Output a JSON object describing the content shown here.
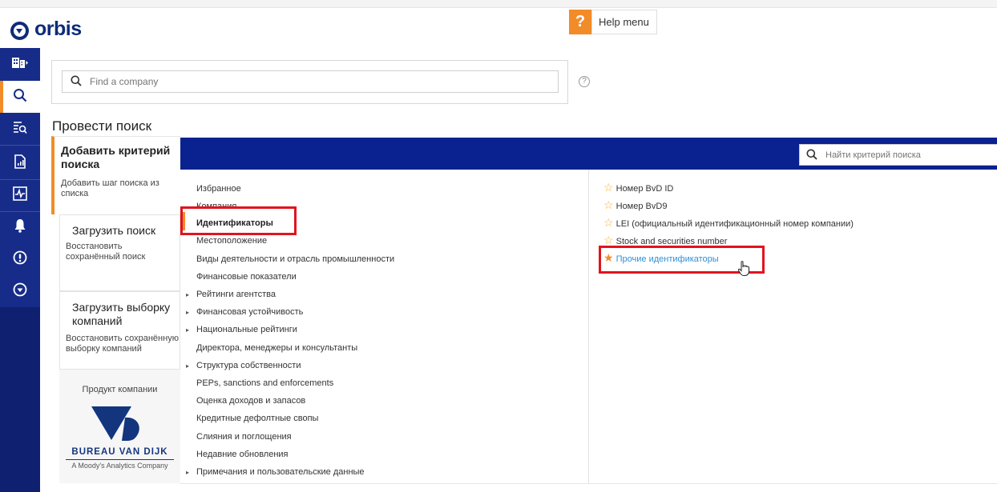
{
  "app": {
    "logo_text": "orbis"
  },
  "help": {
    "icon_glyph": "?",
    "label": "Help menu"
  },
  "search": {
    "placeholder": "Find a company",
    "help_glyph": "?"
  },
  "page": {
    "section_title": "Провести поиск"
  },
  "left_panel": {
    "add": {
      "title": "Добавить критерий поиска",
      "desc": "Добавить шаг поиска из списка"
    },
    "load_search": {
      "title": "Загрузить поиск",
      "desc": "Восстановить сохранённый поиск"
    },
    "load_selection": {
      "title": "Загрузить выборку компаний",
      "desc": "Восстановить сохранённую выборку компаний"
    },
    "footer": {
      "product_label": "Продукт компании",
      "brand": "BUREAU VAN DIJK",
      "tagline": "A Moody's Analytics Company"
    }
  },
  "criteria_search": {
    "placeholder": "Найти критерий поиска"
  },
  "categories": [
    {
      "label": "Избранное",
      "arrow": false
    },
    {
      "label": "Компания",
      "arrow": false
    },
    {
      "label": "Идентификаторы",
      "arrow": false,
      "selected": true
    },
    {
      "label": "Местоположение",
      "arrow": false
    },
    {
      "label": "Виды деятельности и отрасль промышленности",
      "arrow": false
    },
    {
      "label": "Финансовые показатели",
      "arrow": false
    },
    {
      "label": "Рейтинги агентства",
      "arrow": true
    },
    {
      "label": "Финансовая устойчивость",
      "arrow": true
    },
    {
      "label": "Национальные рейтинги",
      "arrow": true
    },
    {
      "label": "Директора, менеджеры и консультанты",
      "arrow": false
    },
    {
      "label": "Структура собственности",
      "arrow": true
    },
    {
      "label": "PEPs, sanctions and enforcements",
      "arrow": false
    },
    {
      "label": "Оценка доходов и запасов",
      "arrow": false
    },
    {
      "label": "Кредитные дефолтные свопы",
      "arrow": false
    },
    {
      "label": "Слияния и поглощения",
      "arrow": false
    },
    {
      "label": "Недавние обновления",
      "arrow": false
    },
    {
      "label": "Примечания и пользовательские данные",
      "arrow": true
    }
  ],
  "criteria": [
    {
      "label": "Номер BvD ID",
      "star": "hollow"
    },
    {
      "label": "Номер BvD9",
      "star": "hollow"
    },
    {
      "label": "LEI (официальный идентификационный номер компании)",
      "star": "hollow"
    },
    {
      "label": "Stock and securities number",
      "star": "hollow"
    },
    {
      "label": "Прочие идентификаторы",
      "star": "filled"
    }
  ],
  "icons": {
    "rail": [
      "building-icon",
      "search-icon",
      "list-search-icon",
      "report-icon",
      "activity-icon",
      "bell-icon",
      "alert-circle-icon",
      "orbis-circle-icon"
    ],
    "star_glyph_hollow": "☆",
    "star_glyph_filled": "★",
    "arrow_glyph": "▸"
  },
  "colors": {
    "brand": "#0f2b7a",
    "rail": "#172c89",
    "accent": "#f28c28",
    "blue_bar": "#0a2290",
    "link": "#2f8fd6",
    "highlight": "#e0141e"
  }
}
